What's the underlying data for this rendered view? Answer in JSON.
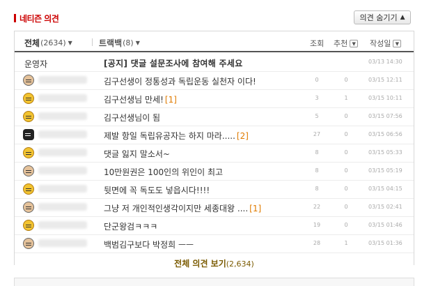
{
  "header": {
    "title": "네티즌 의견",
    "toggle_label": "의견 숨기기"
  },
  "tabs": [
    {
      "label": "전체",
      "count": "(2634)"
    },
    {
      "label": "트랙백",
      "count": "(8)"
    }
  ],
  "columns": {
    "views": "조회",
    "recommend": "추천",
    "date": "작성일"
  },
  "notice": {
    "author": "운영자",
    "text": "[공지] 댓글 설문조사에 참여해 주세요",
    "date": "03/13 14:30"
  },
  "comments": [
    {
      "avatar": "g",
      "text": "김구선생이 정통성과 독립운동 실천자 이다!",
      "reply": "",
      "views": "0",
      "rec": "0",
      "date": "03/15 12:11"
    },
    {
      "avatar": "y",
      "text": "김구선생님 만세!",
      "reply": "[1]",
      "views": "3",
      "rec": "1",
      "date": "03/15 10:11"
    },
    {
      "avatar": "y",
      "text": "김구선생님이 됨",
      "reply": "",
      "views": "5",
      "rec": "0",
      "date": "03/15 07:56"
    },
    {
      "avatar": "b",
      "text": "제발 항일 독립유공자는 하지 마라.....",
      "reply": "[2]",
      "views": "27",
      "rec": "0",
      "date": "03/15 06:56"
    },
    {
      "avatar": "y",
      "text": "댓글 잃지 말소서~",
      "reply": "",
      "views": "8",
      "rec": "0",
      "date": "03/15 05:33"
    },
    {
      "avatar": "g",
      "text": "10만원권은 100인의 위인이 최고",
      "reply": "",
      "views": "8",
      "rec": "0",
      "date": "03/15 05:19"
    },
    {
      "avatar": "y",
      "text": "뒷면에 꼭 독도도 넣읍시다!!!!",
      "reply": "",
      "views": "8",
      "rec": "0",
      "date": "03/15 04:15"
    },
    {
      "avatar": "g",
      "text": "그냥 저 개인적인생각이지만 세종대왕 ....",
      "reply": "[1]",
      "views": "22",
      "rec": "0",
      "date": "03/15 02:41"
    },
    {
      "avatar": "y",
      "text": "단군왕검ㅋㅋㅋ",
      "reply": "",
      "views": "19",
      "rec": "0",
      "date": "03/15 01:46"
    },
    {
      "avatar": "g",
      "text": "백범김구보다 박정희 ㅡㅡ",
      "reply": "",
      "views": "28",
      "rec": "1",
      "date": "03/15 01:36"
    }
  ],
  "more": {
    "label": "전체 의견 보기",
    "count": "(2,634)"
  },
  "colors": {
    "accent": "#cc0000",
    "reply": "#e07b00",
    "more": "#7a5a00"
  }
}
